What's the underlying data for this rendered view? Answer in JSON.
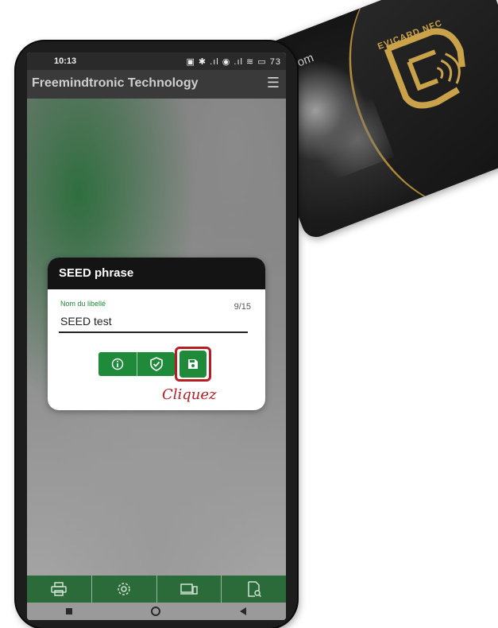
{
  "card": {
    "text": "dom",
    "brand": "EVICARD NFC"
  },
  "statusbar": {
    "time": "10:13",
    "icons": "▣ ✱ .ıl ◉ .ıl ≋ ▭ 73"
  },
  "app": {
    "title": "Freemindtronic Technology",
    "menu_icon": "hamburger-menu-icon"
  },
  "dialog": {
    "title": "SEED phrase",
    "field_label": "Nom du libellé",
    "counter": "9/15",
    "field_value": "SEED test",
    "buttons": [
      "info-icon",
      "shield-icon",
      "save-icon"
    ]
  },
  "annotation": {
    "text": "Cliquez",
    "color": "#b81d24"
  },
  "bottom_nav": {
    "items": [
      "printer-icon",
      "gear-icon",
      "devices-icon",
      "document-search-icon"
    ]
  },
  "system_nav": [
    "square-icon",
    "circle-icon",
    "back-triangle-icon"
  ],
  "colors": {
    "accent": "#1f8a3a",
    "highlight": "#b81d24",
    "appbar": "#3a3a3a"
  }
}
